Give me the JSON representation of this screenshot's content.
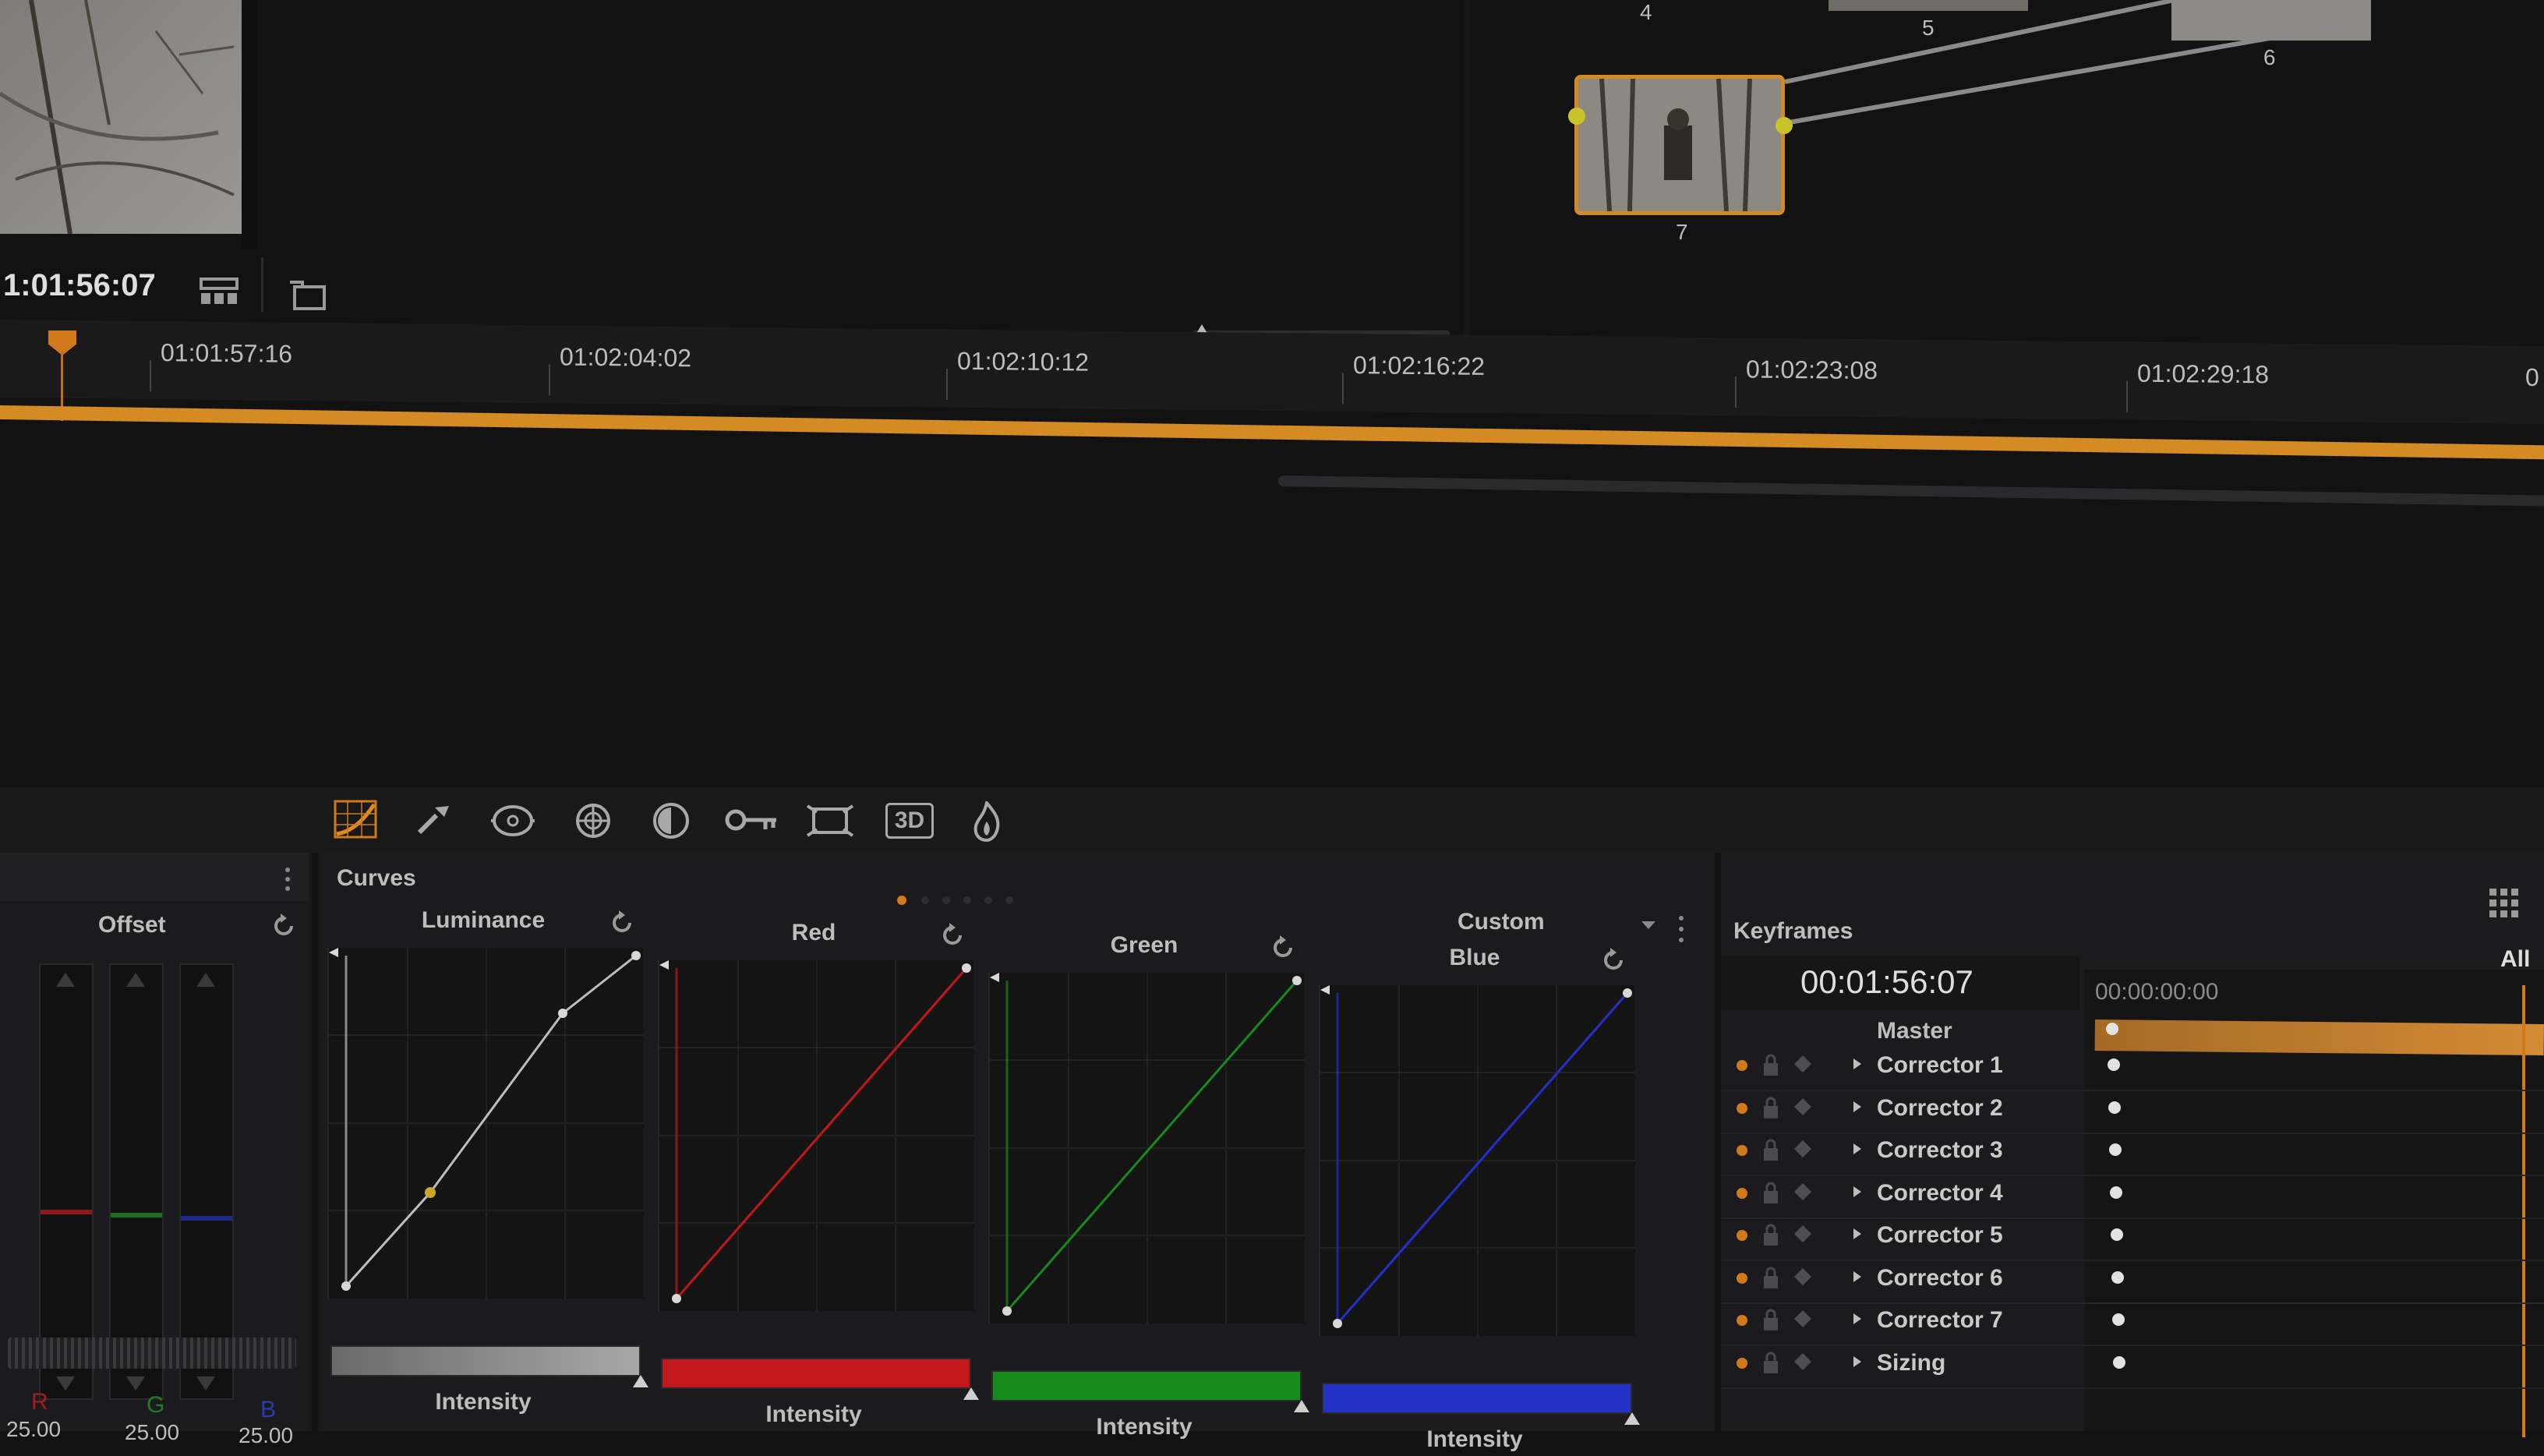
{
  "viewer": {
    "timecode": "1:01:56:07"
  },
  "nodes": [
    {
      "label": "4"
    },
    {
      "label": "5"
    },
    {
      "label": "6"
    },
    {
      "label": "7"
    }
  ],
  "timeline": {
    "ruler": [
      "01:01:57:16",
      "01:02:04:02",
      "01:02:10:12",
      "01:02:16:22",
      "01:02:23:08",
      "01:02:29:18",
      "0"
    ]
  },
  "toolbar": {
    "tools": [
      "curves-icon",
      "eyedropper-icon",
      "window-icon",
      "tracker-icon",
      "blur-icon",
      "key-icon",
      "sizing-icon",
      "3d-icon",
      "flame-icon"
    ],
    "three_d_label": "3D"
  },
  "offset": {
    "title": "Offset",
    "channels": [
      "R",
      "G",
      "B"
    ],
    "values": [
      "25.00",
      "25.00",
      "25.00"
    ]
  },
  "curves": {
    "title": "Curves",
    "mode": "Custom",
    "panels": [
      {
        "name": "Luminance",
        "slider_label": "Intensity",
        "color": "#bdbdbd"
      },
      {
        "name": "Red",
        "slider_label": "Intensity",
        "color": "#c0181c"
      },
      {
        "name": "Green",
        "slider_label": "Intensity",
        "color": "#168a1c"
      },
      {
        "name": "Blue",
        "slider_label": "Intensity",
        "color": "#2231c6"
      }
    ]
  },
  "keyframes": {
    "title": "Keyframes",
    "filter": "All",
    "timecode": "00:01:56:07",
    "start_timecode": "00:00:00:00",
    "master": "Master",
    "tracks": [
      "Corrector 1",
      "Corrector 2",
      "Corrector 3",
      "Corrector 4",
      "Corrector 5",
      "Corrector 6",
      "Corrector 7",
      "Sizing"
    ]
  },
  "colors": {
    "accent": "#e08a1e",
    "background": "#121213",
    "panel": "#1c1c1e"
  }
}
